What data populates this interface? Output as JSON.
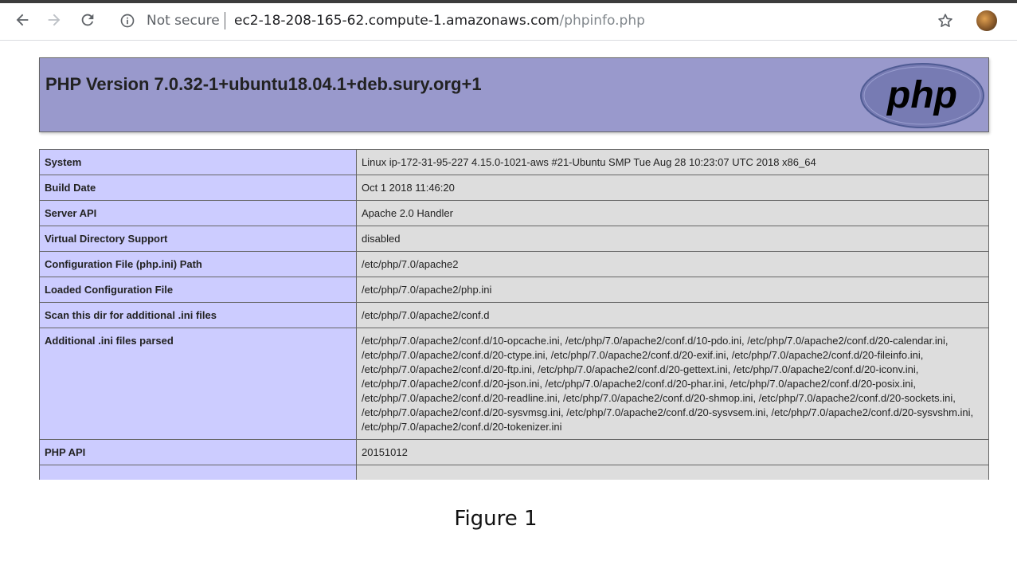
{
  "browser": {
    "security_label": "Not secure",
    "url_host": "ec2-18-208-165-62.compute-1.amazonaws.com",
    "url_path": "/phpinfo.php"
  },
  "php": {
    "title": "PHP Version 7.0.32-1+ubuntu18.04.1+deb.sury.org+1",
    "logo_text": "php",
    "rows": [
      {
        "label": "System",
        "value": "Linux ip-172-31-95-227 4.15.0-1021-aws #21-Ubuntu SMP Tue Aug 28 10:23:07 UTC 2018 x86_64"
      },
      {
        "label": "Build Date",
        "value": "Oct 1 2018 11:46:20"
      },
      {
        "label": "Server API",
        "value": "Apache 2.0 Handler"
      },
      {
        "label": "Virtual Directory Support",
        "value": "disabled"
      },
      {
        "label": "Configuration File (php.ini) Path",
        "value": "/etc/php/7.0/apache2"
      },
      {
        "label": "Loaded Configuration File",
        "value": "/etc/php/7.0/apache2/php.ini"
      },
      {
        "label": "Scan this dir for additional .ini files",
        "value": "/etc/php/7.0/apache2/conf.d"
      },
      {
        "label": "Additional .ini files parsed",
        "value": "/etc/php/7.0/apache2/conf.d/10-opcache.ini, /etc/php/7.0/apache2/conf.d/10-pdo.ini, /etc/php/7.0/apache2/conf.d/20-calendar.ini, /etc/php/7.0/apache2/conf.d/20-ctype.ini, /etc/php/7.0/apache2/conf.d/20-exif.ini, /etc/php/7.0/apache2/conf.d/20-fileinfo.ini, /etc/php/7.0/apache2/conf.d/20-ftp.ini, /etc/php/7.0/apache2/conf.d/20-gettext.ini, /etc/php/7.0/apache2/conf.d/20-iconv.ini, /etc/php/7.0/apache2/conf.d/20-json.ini, /etc/php/7.0/apache2/conf.d/20-phar.ini, /etc/php/7.0/apache2/conf.d/20-posix.ini, /etc/php/7.0/apache2/conf.d/20-readline.ini, /etc/php/7.0/apache2/conf.d/20-shmop.ini, /etc/php/7.0/apache2/conf.d/20-sockets.ini, /etc/php/7.0/apache2/conf.d/20-sysvmsg.ini, /etc/php/7.0/apache2/conf.d/20-sysvsem.ini, /etc/php/7.0/apache2/conf.d/20-sysvshm.ini, /etc/php/7.0/apache2/conf.d/20-tokenizer.ini"
      },
      {
        "label": "PHP API",
        "value": "20151012"
      }
    ]
  },
  "caption": "Figure 1",
  "colors": {
    "header_bg": "#9999cc",
    "label_bg": "#ccccff",
    "value_bg": "#dddddd",
    "logo_bg": "#777bb3"
  }
}
